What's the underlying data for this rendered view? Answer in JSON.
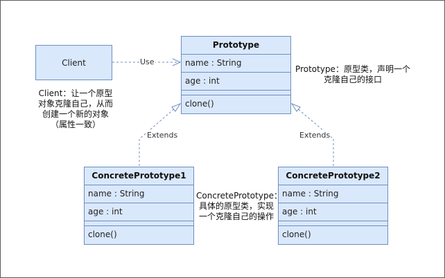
{
  "client": {
    "label": "Client"
  },
  "prototype": {
    "title": "Prototype",
    "attributes": [
      "name : String",
      "age : int"
    ],
    "methods": [
      "clone()"
    ]
  },
  "concrete1": {
    "title": "ConcretePrototype1",
    "attributes": [
      "name : String",
      "age : int"
    ],
    "methods": [
      "clone()"
    ]
  },
  "concrete2": {
    "title": "ConcretePrototype2",
    "attributes": [
      "name : String",
      "age : int"
    ],
    "methods": [
      "clone()"
    ]
  },
  "edges": {
    "use_label": "Use",
    "extends_left_label": "Extends",
    "extends_right_label": "Extends"
  },
  "notes": {
    "client_note": [
      "Client：让一个原型",
      "对象克隆自己，从而",
      "创建一个新的对象",
      "（属性一致）"
    ],
    "prototype_note": [
      "Prototype：原型类，声明一个",
      "克隆自己的接口"
    ],
    "concrete_note": [
      "ConcretePrototype：",
      "具体的原型类，实现",
      "一个克隆自己的操作"
    ]
  },
  "colors": {
    "fill": "#dae8fc",
    "stroke": "#6c8ebf",
    "connector": "#6c8ebf"
  }
}
